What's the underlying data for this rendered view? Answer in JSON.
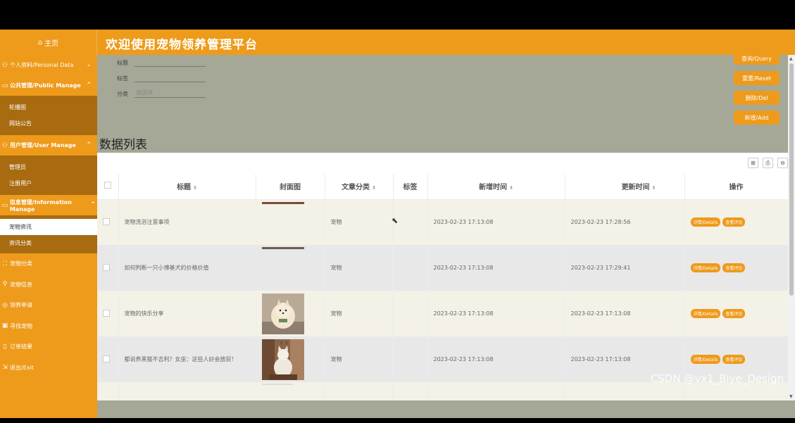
{
  "header": {
    "home_label": "主页",
    "site_title": "欢迎使用宠物领养管理平台"
  },
  "sidebar": {
    "menus": [
      {
        "label": "个人资料/Personal Data",
        "icon": "user-icon",
        "expanded": false
      },
      {
        "label": "公共管理/Public Manage",
        "icon": "board-icon",
        "expanded": true,
        "items": [
          "轮播图",
          "网站公告"
        ]
      },
      {
        "label": "用户管理/User Manage",
        "icon": "users-icon",
        "expanded": true,
        "items": [
          "管理员",
          "注册用户"
        ]
      },
      {
        "label": "信息管理/Information Manage",
        "icon": "info-icon",
        "expanded": true,
        "items": [
          "宠物资讯",
          "资讯分类"
        ]
      },
      {
        "label": "宠物分类",
        "icon": "tag-icon"
      },
      {
        "label": "宠物信息",
        "icon": "paw-icon"
      },
      {
        "label": "领养申请",
        "icon": "apply-icon"
      },
      {
        "label": "寻找宠物",
        "icon": "find-icon"
      },
      {
        "label": "订单结果",
        "icon": "order-icon"
      },
      {
        "label": "退出/Exit",
        "icon": "exit-icon"
      }
    ],
    "current_item": "宠物资讯"
  },
  "search": {
    "title_label": "标题",
    "tag_label": "标签",
    "category_label": "分类",
    "category_placeholder": "请选择"
  },
  "actions": {
    "query": "查询/Query",
    "reset": "重置/Reset",
    "delete": "删除/Del",
    "add": "新增/Add"
  },
  "list": {
    "title": "数据列表",
    "columns": [
      "标题",
      "封面图",
      "文章分类",
      "标签",
      "新增时间",
      "更新时间",
      "操作"
    ],
    "rows": [
      {
        "title": "宠物洗浴注意事项",
        "category": "宠物",
        "tag": "",
        "created": "2023-02-23 17:13:08",
        "updated": "2023-02-23 17:28:56"
      },
      {
        "title": "如何判断一只小博基犬的价格价值",
        "category": "宠物",
        "tag": "",
        "created": "2023-02-23 17:13:08",
        "updated": "2023-02-23 17:29:41"
      },
      {
        "title": "宠物的快乐分享",
        "category": "宠物",
        "tag": "",
        "created": "2023-02-23 17:13:08",
        "updated": "2023-02-23 17:13:08"
      },
      {
        "title": "都说养黑猫不吉利？女巫：这些人好会放屁！",
        "category": "宠物",
        "tag": "",
        "created": "2023-02-23 17:13:08",
        "updated": "2023-02-23 17:13:08"
      }
    ],
    "row_buttons": {
      "details": "详情/Details",
      "comments": "查看评论"
    }
  },
  "watermark": "CSDN @vx1_Biye_Design",
  "colors": {
    "accent": "#ee9a1a",
    "sidebar_sub": "#a86b10",
    "content_bg": "#a5a896"
  }
}
